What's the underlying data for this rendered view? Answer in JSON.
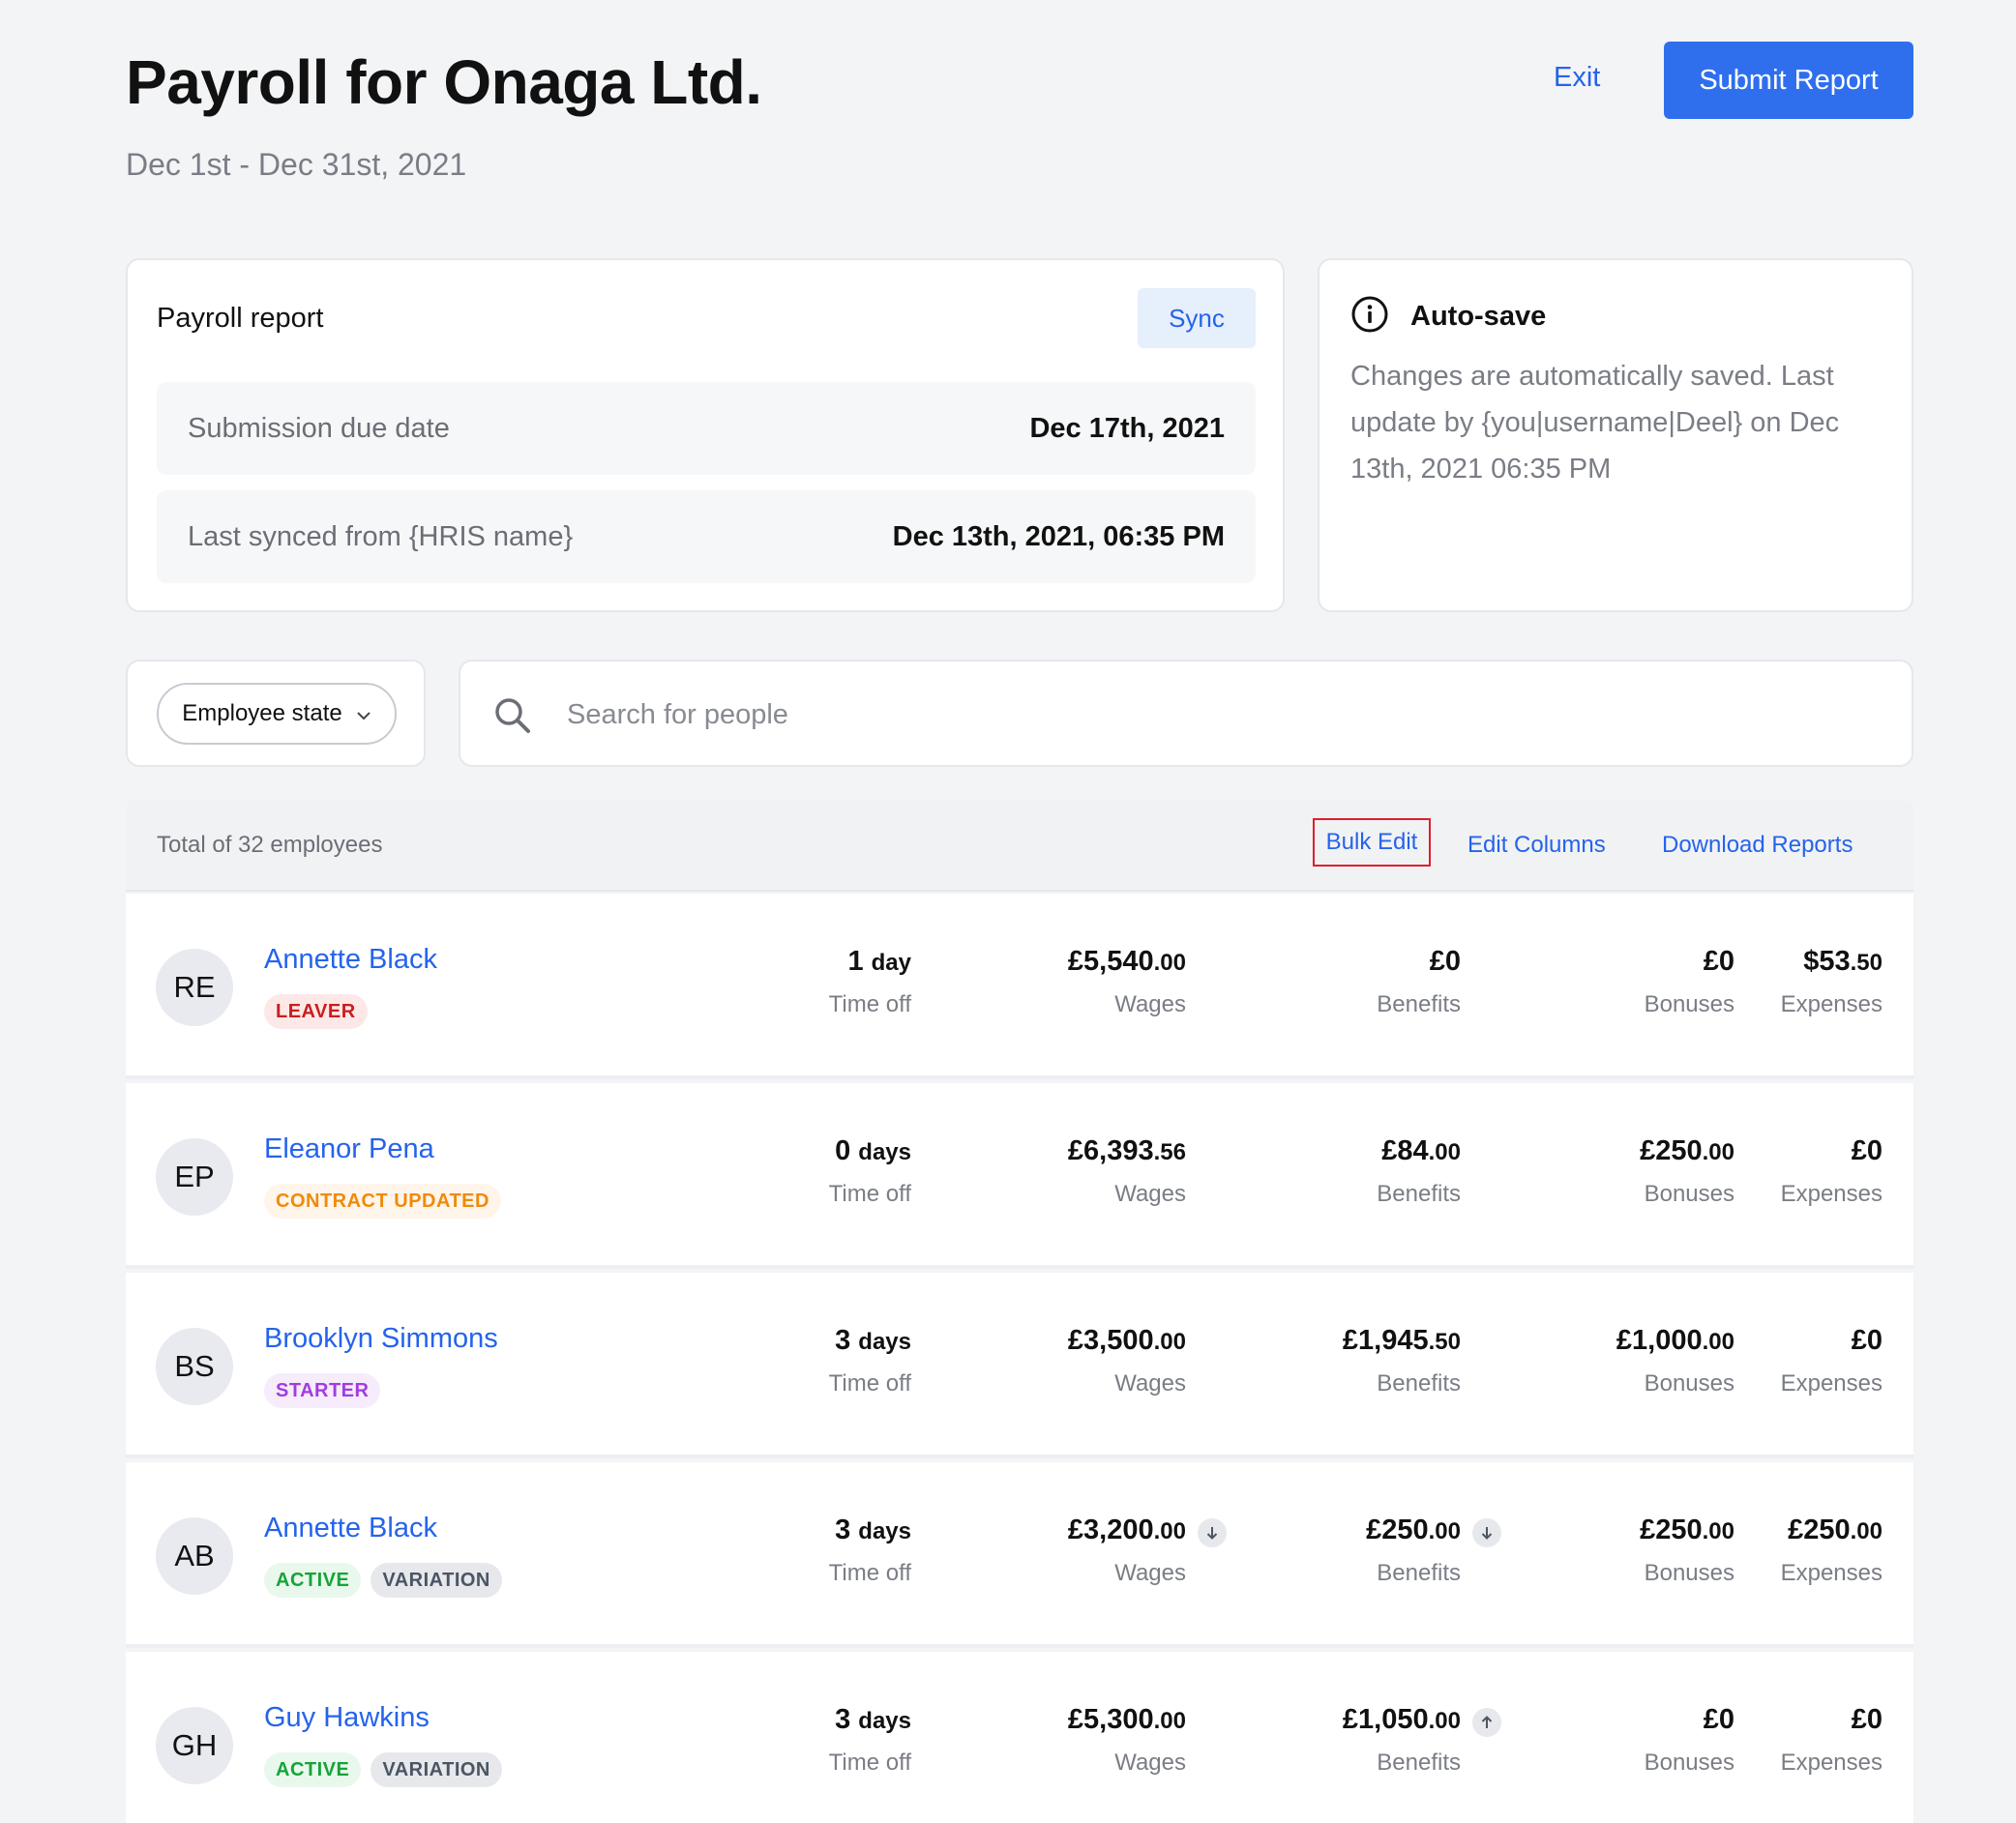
{
  "header": {
    "title": "Payroll for Onaga Ltd.",
    "period": "Dec 1st - Dec 31st, 2021",
    "exit_label": "Exit",
    "submit_label": "Submit Report"
  },
  "report_card": {
    "title": "Payroll report",
    "sync_label": "Sync",
    "due_label": "Submission due date",
    "due_value": "Dec 17th, 2021",
    "synced_label": "Last synced from {HRIS name}",
    "synced_value": "Dec 13th, 2021, 06:35 PM"
  },
  "autosave": {
    "title": "Auto-save",
    "text": "Changes are automatically saved. Last update by {you|username|Deel} on Dec 13th, 2021 06:35 PM",
    "icon": "info-icon"
  },
  "filters": {
    "employee_state_label": "Employee state",
    "search_placeholder": "Search for people"
  },
  "table": {
    "total_text": "Total of 32 employees",
    "bulk_edit": "Bulk Edit",
    "edit_columns": "Edit Columns",
    "download_reports": "Download Reports",
    "labels": {
      "time_off": "Time off",
      "wages": "Wages",
      "benefits": "Benefits",
      "bonuses": "Bonuses",
      "expenses": "Expenses"
    },
    "rows": [
      {
        "initials": "RE",
        "name": "Annette Black",
        "badges": [
          {
            "text": "LEAVER",
            "kind": "leaver"
          }
        ],
        "time_off_num": "1",
        "time_off_unit": "day",
        "wages_main": "£5,540",
        "wages_cents": ".00",
        "benefits_main": "£0",
        "benefits_cents": "",
        "bonuses_main": "£0",
        "bonuses_cents": "",
        "expenses_main": "$53",
        "expenses_cents": ".50"
      },
      {
        "initials": "EP",
        "name": "Eleanor Pena",
        "badges": [
          {
            "text": "CONTRACT UPDATED",
            "kind": "contract"
          }
        ],
        "time_off_num": "0",
        "time_off_unit": "days",
        "wages_main": "£6,393",
        "wages_cents": ".56",
        "benefits_main": "£84",
        "benefits_cents": ".00",
        "bonuses_main": "£250",
        "bonuses_cents": ".00",
        "expenses_main": "£0",
        "expenses_cents": ""
      },
      {
        "initials": "BS",
        "name": "Brooklyn Simmons",
        "badges": [
          {
            "text": "STARTER",
            "kind": "starter"
          }
        ],
        "time_off_num": "3",
        "time_off_unit": "days",
        "wages_main": "£3,500",
        "wages_cents": ".00",
        "benefits_main": "£1,945",
        "benefits_cents": ".50",
        "bonuses_main": "£1,000",
        "bonuses_cents": ".00",
        "expenses_main": "£0",
        "expenses_cents": ""
      },
      {
        "initials": "AB",
        "name": "Annette Black",
        "badges": [
          {
            "text": "ACTIVE",
            "kind": "active"
          },
          {
            "text": "VARIATION",
            "kind": "variation"
          }
        ],
        "time_off_num": "3",
        "time_off_unit": "days",
        "wages_main": "£3,200",
        "wages_cents": ".00",
        "wages_trend": "down",
        "benefits_main": "£250",
        "benefits_cents": ".00",
        "benefits_trend": "down",
        "bonuses_main": "£250",
        "bonuses_cents": ".00",
        "expenses_main": "£250",
        "expenses_cents": ".00"
      },
      {
        "initials": "GH",
        "name": "Guy Hawkins",
        "badges": [
          {
            "text": "ACTIVE",
            "kind": "active"
          },
          {
            "text": "VARIATION",
            "kind": "variation"
          }
        ],
        "time_off_num": "3",
        "time_off_unit": "days",
        "wages_main": "£5,300",
        "wages_cents": ".00",
        "benefits_main": "£1,050",
        "benefits_cents": ".00",
        "benefits_trend": "up",
        "bonuses_main": "£0",
        "bonuses_cents": "",
        "expenses_main": "£0",
        "expenses_cents": ""
      }
    ]
  },
  "colors": {
    "accent": "#2f6fed",
    "link": "#2563eb",
    "highlight_border": "#e01e2c"
  }
}
